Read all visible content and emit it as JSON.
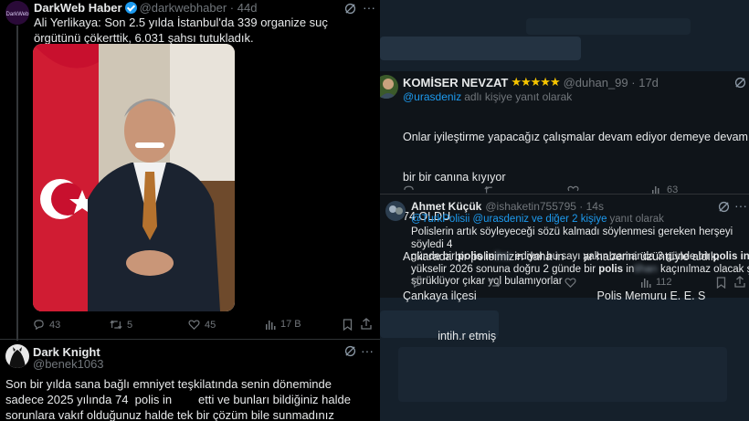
{
  "left": {
    "tweet1": {
      "author": "DarkWeb Haber",
      "handle": "@darkwebhaber",
      "time": "44d",
      "text": "Ali Yerlikaya: Son 2.5 yılda İstanbul'da 339 organize suç örgütünü çökerttik, 6.031 şahsı tutukladık.",
      "replies": "43",
      "retweets": "5",
      "likes": "45",
      "views": "17 B"
    },
    "tweet2": {
      "author": "Dark Knight",
      "handle": "@benek1063",
      "text": "Son bir yılda sana bağlı emniyet teşkilatında senin döneminde sadece 2025 yılında 74  polis in        etti ve bunları bildiğiniz halde sorunlara vakıf olduğunuz halde tek bir çözüm bile sunmadınız teşkilata !"
    }
  },
  "right": {
    "tweet1": {
      "author": "KOMİSER NEVZAT",
      "stars": "★★★★★",
      "handle": "@duhan_99",
      "time": "17d",
      "reply_to": "@urasdeniz",
      "reply_suffix": "adlı kişiye yanıt olarak",
      "line1": "Onlar iyileştirme yapacağız çalışmalar devam ediyor demeye devam etsin Polisler",
      "line2": "bir bir canına kıyıyor",
      "line3": "74 OLDU",
      "line4": "Ankarada bir polisimizin daha in      ar haberini üzüntüyle aldık.",
      "line5": "Çankaya ilçesi                                      Polis Memuru E. E. S",
      "line6": "           intih.r etmiş",
      "views": "63"
    },
    "tweet2": {
      "author": "Ahmet Küçük",
      "handle": "@ishaketin755795",
      "time": "14s",
      "reply_to": "@TurkPolisii @urasdeniz",
      "reply_and": "ve diğer 2 kişiye",
      "reply_suffix": "yanıt olarak",
      "line1": "Polislerin artık söyleyeceği sözü kalmadı söylenmesi gereken herşeyi söyledi 4",
      "line2a": "günde bir",
      "line2b": "polis in",
      "line2c": "ediyor bu sayı yakın zamanda 3 günde bir",
      "line2d": "polis in",
      "line3": "yükselir 2026 sonuna doğru 2 günde bir",
      "line3b": "polis",
      "line3c": "in",
      "line3d": "kaçınılmaz olacak şartlar",
      "line4": "sürüklüyor çıkar yol bulamıyorlar",
      "views": "112"
    }
  },
  "colors": {
    "left_bg": "#000000",
    "right_bg": "#15202b",
    "accent": "#1d9bf0",
    "muted": "#71767b",
    "star": "#f5c400",
    "grok": "#1d9bf0"
  }
}
